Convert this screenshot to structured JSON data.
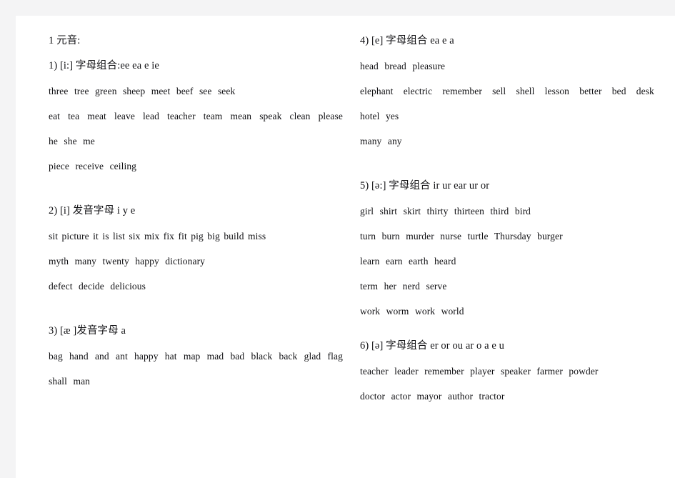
{
  "document": {
    "title": "1 元音:",
    "page_background": "#ffffff",
    "margin_background": "#f4f4f5",
    "text_color": "#111114"
  },
  "columns": {
    "left": {
      "heading": "1 元音:",
      "sections": [
        {
          "number": "1)",
          "phoneme": "[i:]",
          "rule_label": "字母组合",
          "separator": ":",
          "letters": "ee ea e ie",
          "heading_text": "1) [i:] 字母组合:ee ea e ie",
          "word_rows": [
            {
              "text": "three tree green sheep meet beef see seek",
              "words": [
                "three",
                "tree",
                "green",
                "sheep",
                "meet",
                "beef",
                "see",
                "seek"
              ],
              "justified": false
            },
            {
              "text": "eat tea meat leave lead teacher team mean speak clean please",
              "words": [
                "eat",
                "tea",
                "meat",
                "leave",
                "lead",
                "teacher",
                "team",
                "mean",
                "speak",
                "clean",
                "please"
              ],
              "justified": true
            },
            {
              "text": "he she me",
              "words": [
                "he",
                "she",
                "me"
              ],
              "justified": false
            },
            {
              "text": "piece receive ceiling",
              "words": [
                "piece",
                "receive",
                "ceiling"
              ],
              "justified": false
            }
          ]
        },
        {
          "number": "2)",
          "phoneme": "[i]",
          "rule_label": "发音字母",
          "separator": " ",
          "letters": "i y e",
          "heading_text": "2) [i] 发音字母 i y e",
          "word_rows": [
            {
              "text": "sit picture it is list six mix fix fit pig big build miss",
              "words": [
                "sit",
                "picture",
                "it",
                "is",
                "list",
                "six",
                "mix",
                "fix",
                "fit",
                "pig",
                "big",
                "build",
                "miss"
              ],
              "justified": false
            },
            {
              "text": "myth many twenty happy dictionary",
              "words": [
                "myth",
                "many",
                "twenty",
                "happy",
                "dictionary"
              ],
              "justified": false
            },
            {
              "text": "defect decide delicious",
              "words": [
                "defect",
                "decide",
                "delicious"
              ],
              "justified": false
            }
          ]
        },
        {
          "number": "3)",
          "phoneme": "[æ ]",
          "rule_label": "发音字母",
          "separator": "",
          "letters": "a",
          "heading_text": "3) [æ ]发音字母 a",
          "word_rows": [
            {
              "text": "bag hand and ant happy hat map mad bad black back glad flag",
              "words": [
                "bag",
                "hand",
                "and",
                "ant",
                "happy",
                "hat",
                "map",
                "mad",
                "bad",
                "black",
                "back",
                "glad",
                "flag"
              ],
              "justified": true
            },
            {
              "text": "shall man",
              "words": [
                "shall",
                "man"
              ],
              "justified": false
            }
          ]
        }
      ]
    },
    "right": {
      "sections": [
        {
          "number": "4)",
          "phoneme": "[e]",
          "rule_label": "字母组合",
          "separator": " ",
          "letters": "ea e a",
          "heading_text": "4) [e] 字母组合 ea e a",
          "word_rows": [
            {
              "text": "head bread pleasure",
              "words": [
                "head",
                "bread",
                "pleasure"
              ],
              "justified": false
            },
            {
              "text": "elephant electric remember sell shell lesson better bed desk",
              "words": [
                "elephant",
                "electric",
                "remember",
                "sell",
                "shell",
                "lesson",
                "better",
                "bed",
                "desk"
              ],
              "justified": true
            },
            {
              "text": "hotel yes",
              "words": [
                "hotel",
                "yes"
              ],
              "justified": false
            },
            {
              "text": "many any",
              "words": [
                "many",
                "any"
              ],
              "justified": false
            }
          ]
        },
        {
          "number": "5)",
          "phoneme": "[ə:]",
          "rule_label": "字母组合",
          "separator": " ",
          "letters": "ir ur ear ur or",
          "heading_text": "5) [ə:] 字母组合 ir ur ear ur or",
          "word_rows": [
            {
              "text": "girl shirt skirt thirty thirteen third bird",
              "words": [
                "girl",
                "shirt",
                "skirt",
                "thirty",
                "thirteen",
                "third",
                "bird"
              ],
              "justified": false
            },
            {
              "text": "turn burn murder nurse turtle Thursday burger",
              "words": [
                "turn",
                "burn",
                "murder",
                "nurse",
                "turtle",
                "Thursday",
                "burger"
              ],
              "justified": false
            },
            {
              "text": "learn earn earth heard",
              "words": [
                "learn",
                "earn",
                "earth",
                "heard"
              ],
              "justified": false
            },
            {
              "text": "term her nerd serve",
              "words": [
                "term",
                "her",
                "nerd",
                "serve"
              ],
              "justified": false
            },
            {
              "text": "work worm work world",
              "words": [
                "work",
                "worm",
                "work",
                "world"
              ],
              "justified": false
            }
          ]
        },
        {
          "number": "6)",
          "phoneme": "[ə]",
          "rule_label": "字母组合",
          "separator": " ",
          "letters": "er or ou ar o a e u",
          "heading_text": "6) [ə] 字母组合 er or ou ar o a e u",
          "word_rows": [
            {
              "text": "teacher leader remember player speaker farmer powder",
              "words": [
                "teacher",
                "leader",
                "remember",
                "player",
                "speaker",
                "farmer",
                "powder"
              ],
              "justified": false
            },
            {
              "text": "doctor actor mayor author tractor",
              "words": [
                "doctor",
                "actor",
                "mayor",
                "author",
                "tractor"
              ],
              "justified": false
            }
          ]
        }
      ]
    }
  }
}
